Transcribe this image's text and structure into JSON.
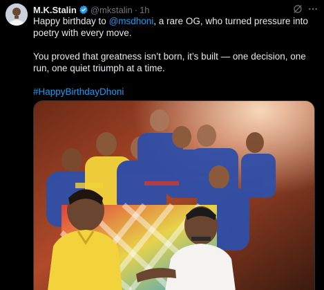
{
  "author": {
    "name": "M.K.Stalin",
    "handle": "@mkstalin",
    "separator": "·",
    "time": "1h",
    "verified": true
  },
  "icons": {
    "avatar": "profile-avatar",
    "verified": "verified-badge-icon",
    "grok": "grok-icon",
    "more": "more-options-icon"
  },
  "tweet": {
    "line1_prefix": "Happy birthday to ",
    "mention": "@msdhoni",
    "line1_suffix": ", a rare OG, who turned pressure into poetry with every move.",
    "line2": "You proved that greatness isn’t born, it’s built — one decision, one run, one quiet triumph at a time.",
    "hashtag": "#HappyBirthdayDhoni"
  },
  "media": {
    "type": "photo"
  },
  "colors": {
    "background": "#000000",
    "text": "#e7e9ea",
    "muted": "#71767b",
    "link": "#1d9bf0",
    "verified": "#1d9bf0",
    "team_yellow": "#f3d33c",
    "team_blue": "#2f4fa8"
  }
}
